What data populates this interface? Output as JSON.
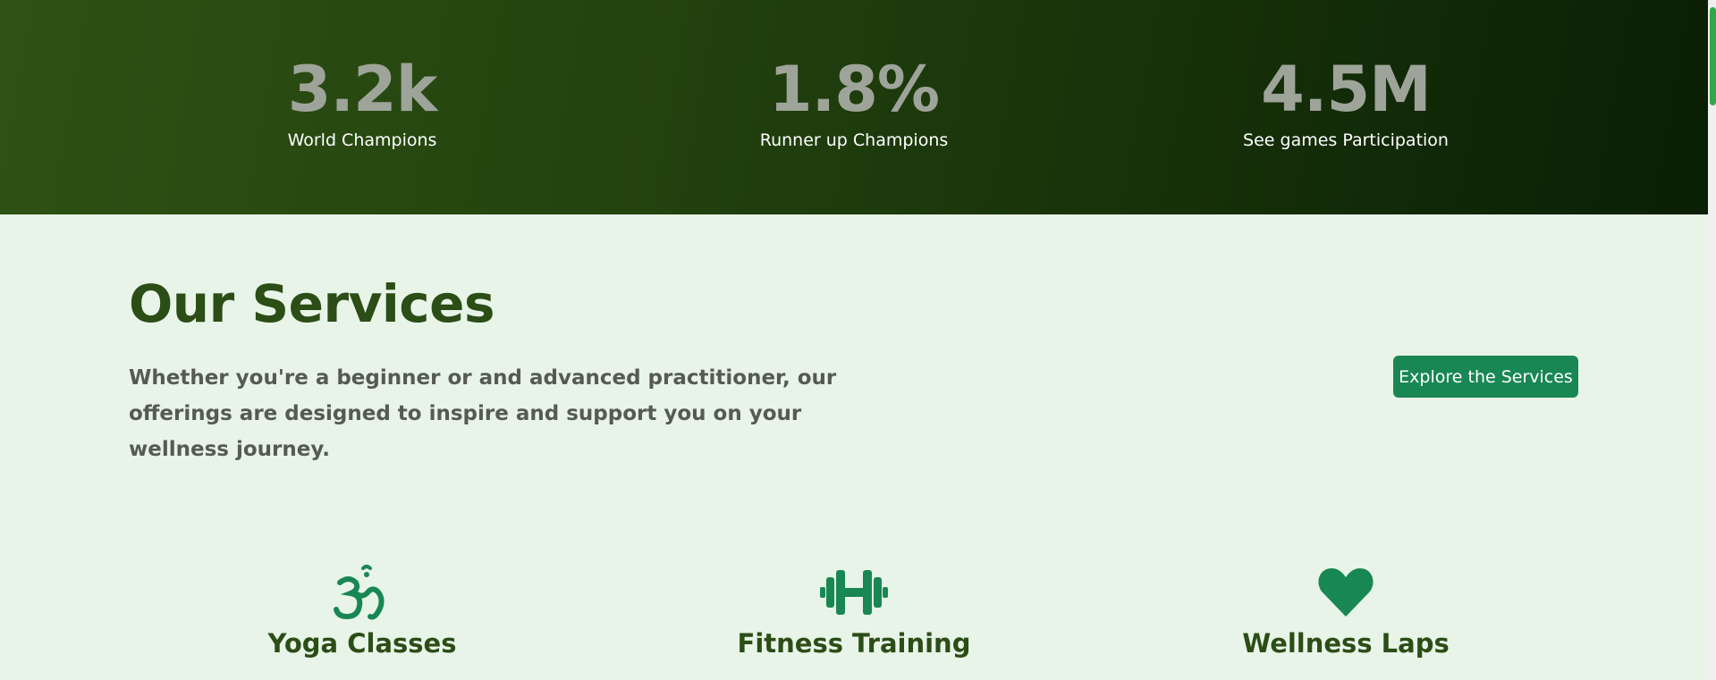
{
  "stats": [
    {
      "value": "3.2k",
      "label": "World Champions"
    },
    {
      "value": "1.8%",
      "label": "Runner up Champions"
    },
    {
      "value": "4.5M",
      "label": "See games Participation"
    }
  ],
  "services_section": {
    "title": "Our Services",
    "description": "Whether you're a beginner or and advanced practitioner, our offerings are designed to inspire and support you on your wellness journey.",
    "button_label": "Explore the Services"
  },
  "services": [
    {
      "icon": "om-icon",
      "title": "Yoga Classes"
    },
    {
      "icon": "dumbbell-icon",
      "title": "Fitness Training"
    },
    {
      "icon": "heart-icon",
      "title": "Wellness Laps"
    }
  ],
  "colors": {
    "banner_start": "#2e5215",
    "banner_end": "#0a1f05",
    "page_bg": "#e8f4e8",
    "heading": "#2b4d16",
    "accent": "#198754",
    "stat_value": "#9ea49a",
    "scroll_thumb": "#2fa84a"
  }
}
